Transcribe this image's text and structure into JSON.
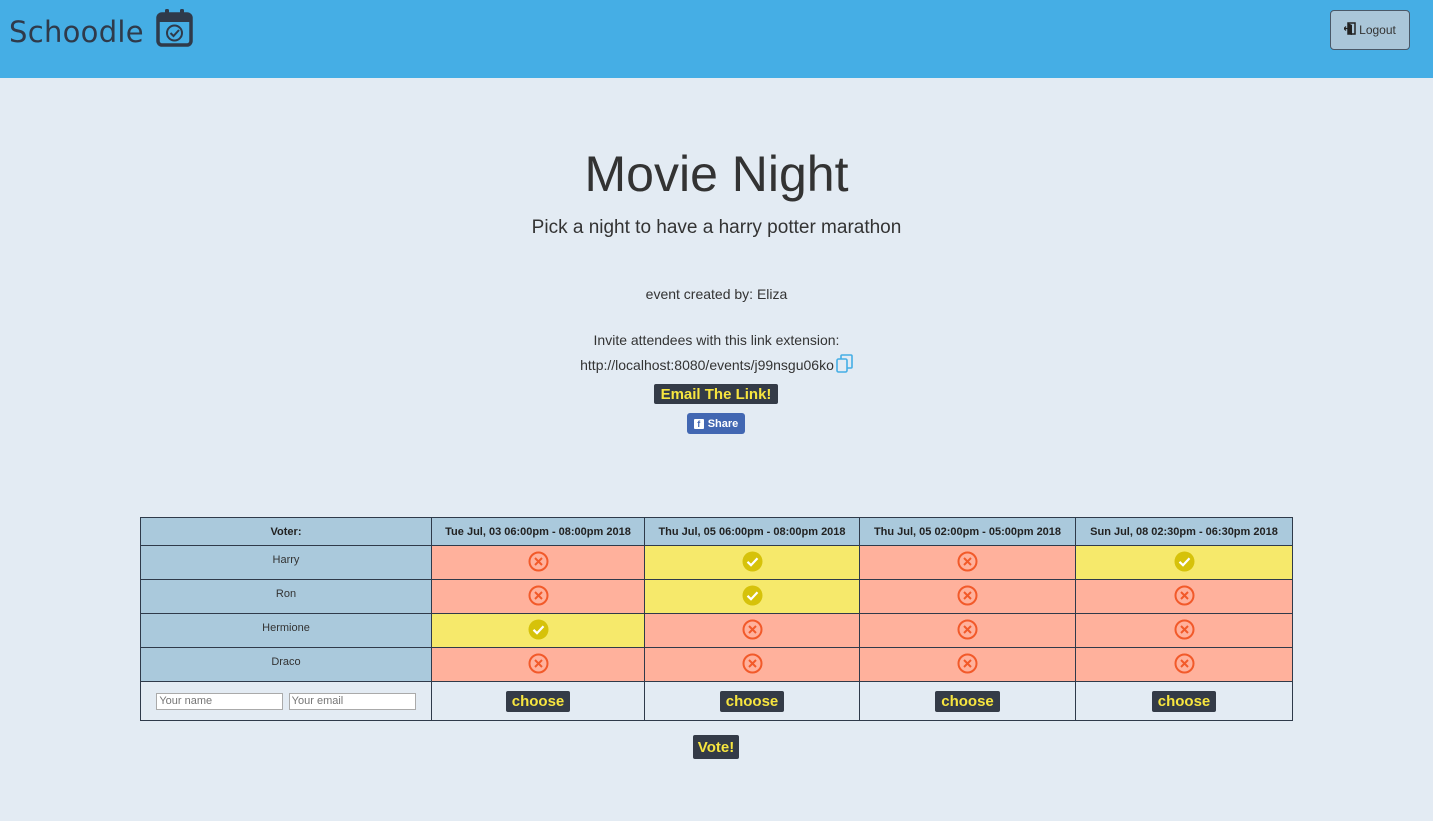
{
  "navbar": {
    "brand": "Schoodle",
    "brand_icon": "calendar-check-icon",
    "logout_label": "Logout",
    "logout_icon": "door-exit-icon",
    "color": "#45aee5"
  },
  "event": {
    "title": "Movie Night",
    "description": "Pick a night to have a harry potter marathon",
    "creator_text": "event created by: Eliza",
    "invite_text": "Invite attendees with this link extension:",
    "link": "http://localhost:8080/events/j99nsgu06ko",
    "email_button": "Email The Link!",
    "share_button": "Share"
  },
  "poll": {
    "voter_header": "Voter:",
    "dates": [
      "Tue Jul, 03 06:00pm - 08:00pm 2018",
      "Thu Jul, 05 06:00pm - 08:00pm 2018",
      "Thu Jul, 05 02:00pm - 05:00pm 2018",
      "Sun Jul, 08 02:30pm - 06:30pm 2018"
    ],
    "voters": [
      {
        "name": "Harry",
        "votes": [
          false,
          true,
          false,
          true
        ]
      },
      {
        "name": "Ron",
        "votes": [
          false,
          true,
          false,
          false
        ]
      },
      {
        "name": "Hermione",
        "votes": [
          true,
          false,
          false,
          false
        ]
      },
      {
        "name": "Draco",
        "votes": [
          false,
          false,
          false,
          false
        ]
      }
    ],
    "name_placeholder": "Your name",
    "email_placeholder": "Your email",
    "choose_label": "choose",
    "vote_label": "Vote!",
    "colors": {
      "yes": "#f6e96b",
      "no": "#ffb19c",
      "header": "#aac9dc",
      "button": "#343b47",
      "button_text": "#f7e53f"
    }
  }
}
